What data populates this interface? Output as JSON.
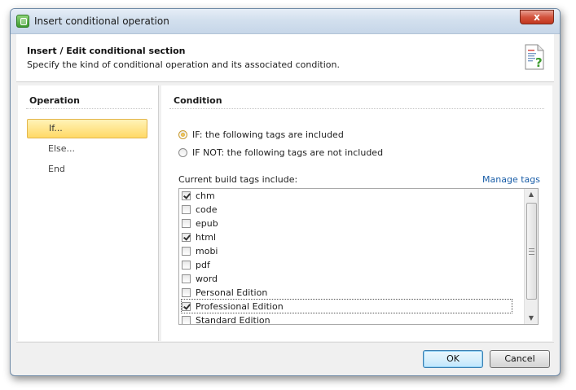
{
  "window": {
    "title": "Insert conditional operation",
    "close_glyph": "x"
  },
  "header": {
    "title": "Insert / Edit conditional section",
    "subtitle": "Specify the kind of conditional operation and its associated condition.",
    "icon": "document-question-icon"
  },
  "operation": {
    "header": "Operation",
    "items": [
      {
        "label": "If...",
        "selected": true
      },
      {
        "label": "Else...",
        "selected": false
      },
      {
        "label": "End",
        "selected": false
      }
    ]
  },
  "condition": {
    "header": "Condition",
    "options": [
      {
        "label": "IF: the following tags are included",
        "checked": true
      },
      {
        "label": "IF NOT: the following tags are not included",
        "checked": false
      }
    ],
    "tags_label": "Current build tags include:",
    "manage_link": "Manage tags",
    "tags": [
      {
        "label": "chm",
        "checked": true
      },
      {
        "label": "code",
        "checked": false
      },
      {
        "label": "epub",
        "checked": false
      },
      {
        "label": "html",
        "checked": true
      },
      {
        "label": "mobi",
        "checked": false
      },
      {
        "label": "pdf",
        "checked": false
      },
      {
        "label": "word",
        "checked": false
      },
      {
        "label": "Personal Edition",
        "checked": false
      },
      {
        "label": "Professional Edition",
        "checked": true
      },
      {
        "label": "Standard Edition",
        "checked": false
      }
    ]
  },
  "buttons": {
    "ok": "OK",
    "cancel": "Cancel"
  },
  "colors": {
    "selection_fill": "#ffd966",
    "link": "#1a5ea8",
    "default_button_border": "#3c7fb1"
  }
}
